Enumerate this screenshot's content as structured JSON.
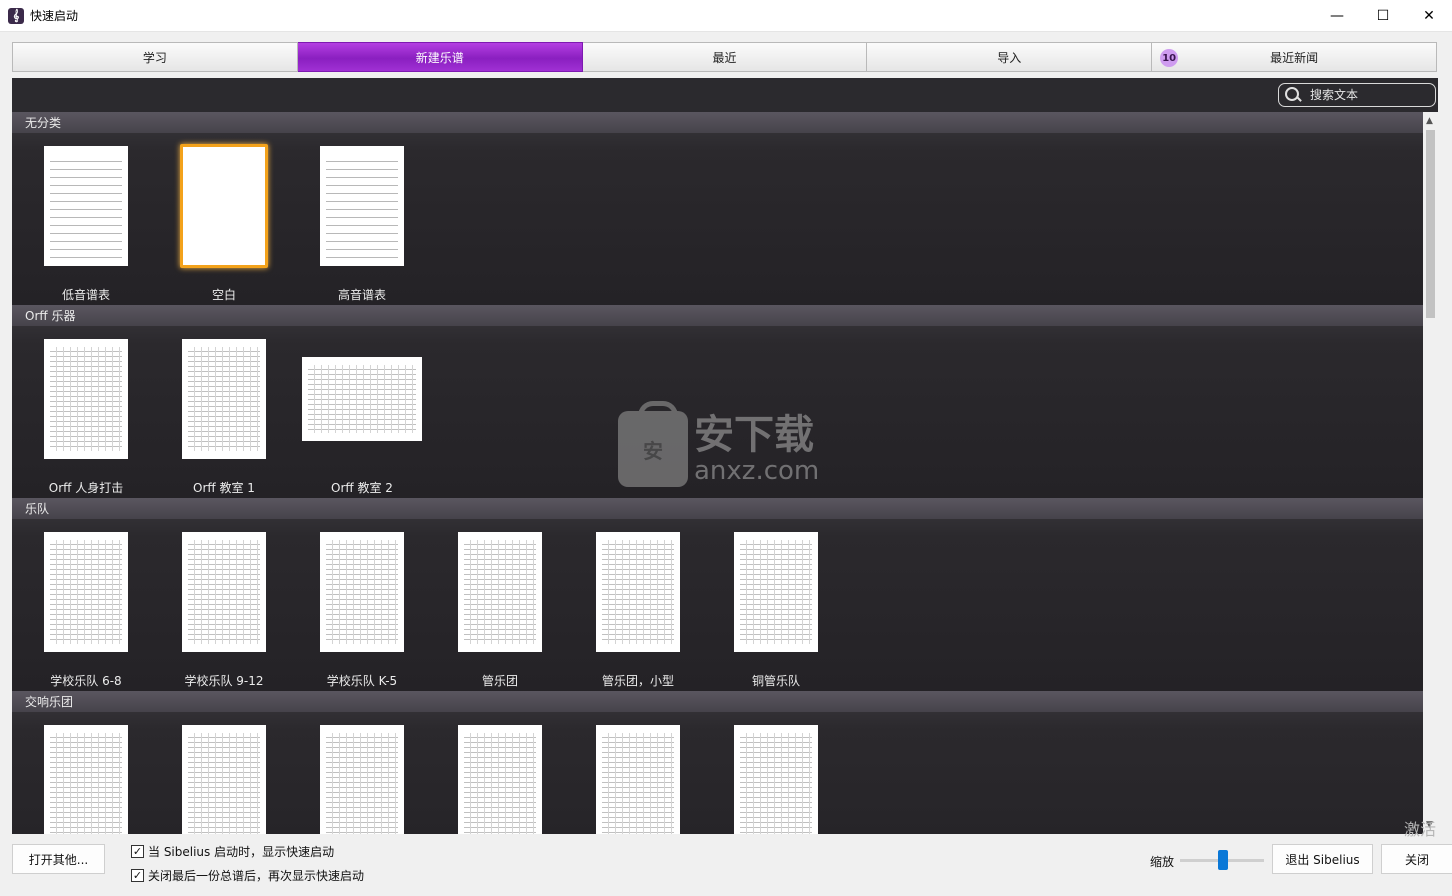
{
  "window": {
    "title": "快速启动",
    "controls": [
      "—",
      "☐",
      "✕"
    ]
  },
  "tabs": [
    {
      "label": "学习",
      "active": false
    },
    {
      "label": "新建乐谱",
      "active": true
    },
    {
      "label": "最近",
      "active": false
    },
    {
      "label": "导入",
      "active": false
    },
    {
      "label": "最近新闻",
      "active": false,
      "badge": "10"
    }
  ],
  "search": {
    "placeholder": "搜索文本"
  },
  "sections": [
    {
      "title": "无分类",
      "items": [
        "低音谱表",
        "空白",
        "高音谱表"
      ]
    },
    {
      "title": "Orff 乐器",
      "items": [
        "Orff 人身打击",
        "Orff 教室 1",
        "Orff 教室 2"
      ]
    },
    {
      "title": "乐队",
      "items": [
        "学校乐队 6-8",
        "学校乐队 9-12",
        "学校乐队 K-5",
        "管乐团",
        "管乐团，小型",
        "铜管乐队"
      ]
    },
    {
      "title": "交响乐团",
      "items": [
        "",
        "",
        "",
        "",
        "",
        ""
      ]
    }
  ],
  "watermark": {
    "cn": "安下载",
    "en": "anxz.com",
    "badge": "安"
  },
  "bottom": {
    "open_other": "打开其他...",
    "check1": "当 Sibelius 启动时，显示快速启动",
    "check2": "关闭最后一份总谱后，再次显示快速启动",
    "zoom_label": "缩放",
    "exit_button": "退出 Sibelius",
    "close_button": "关闭",
    "activate_text": "激活"
  },
  "colors": {
    "accent": "#9b2ad0",
    "selected_border": "#f3a21b",
    "dark_bg": "#2d2b30"
  }
}
